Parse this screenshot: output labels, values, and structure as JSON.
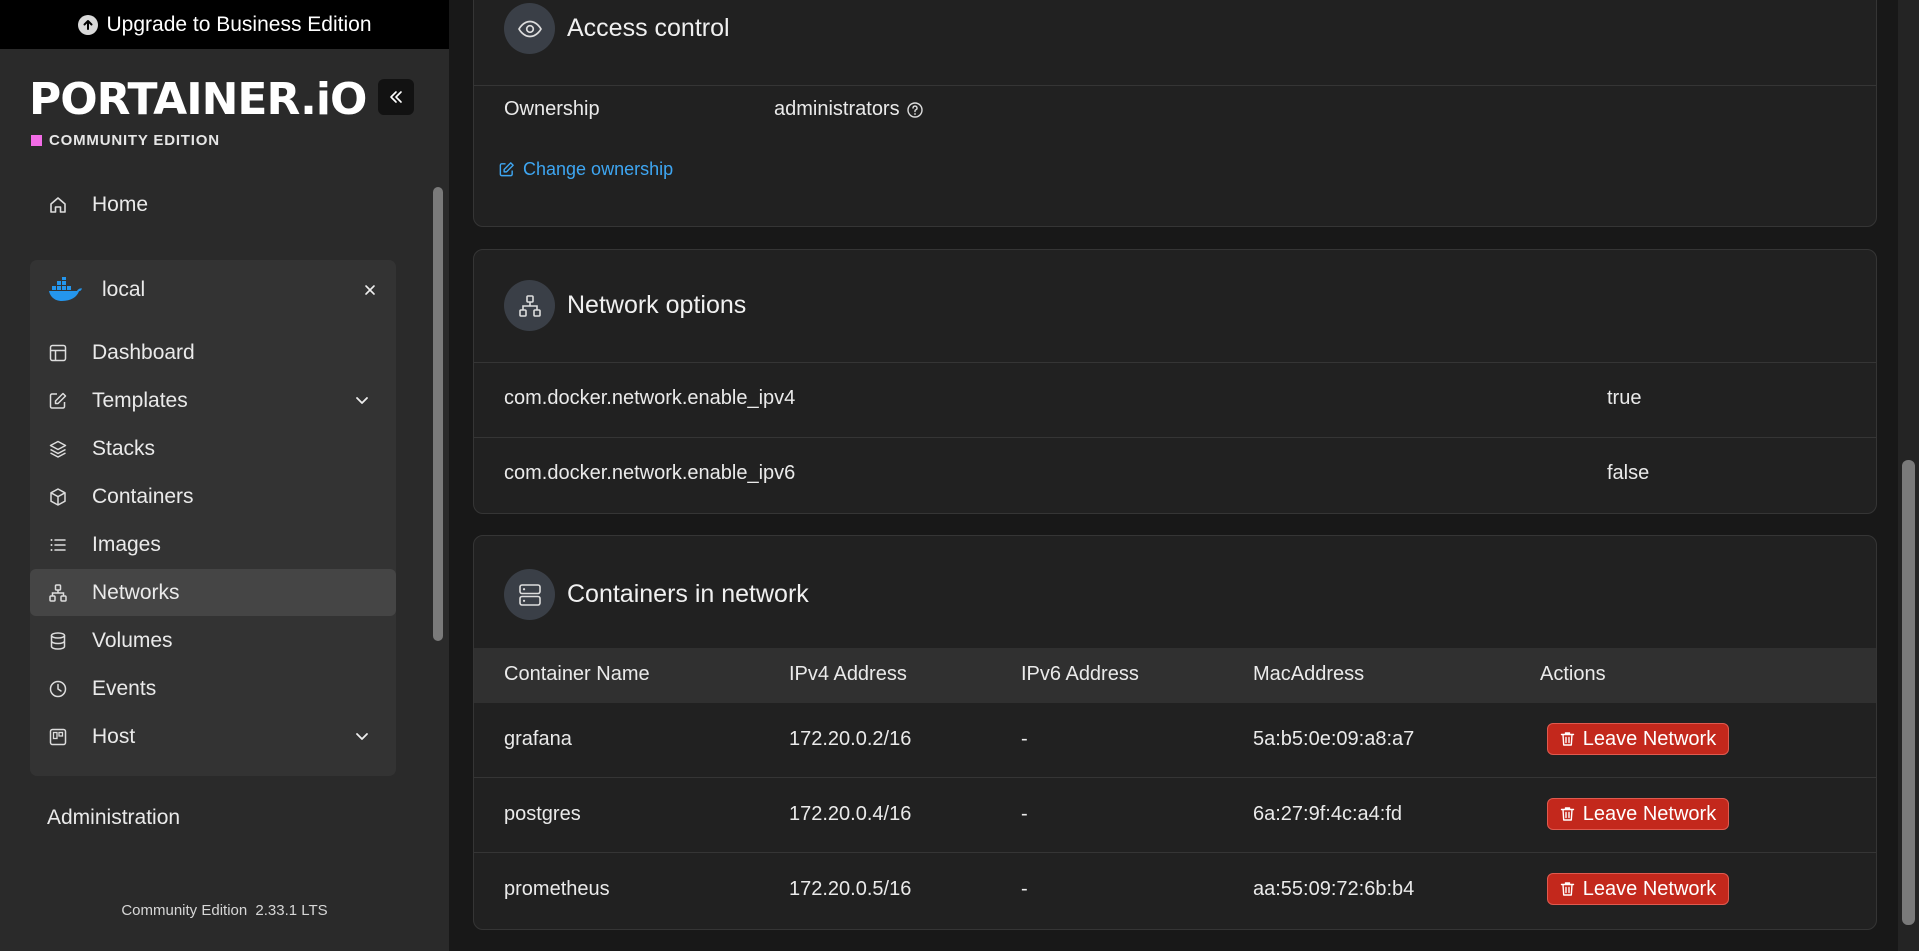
{
  "upgrade": {
    "label": "Upgrade to Business Edition"
  },
  "brand": {
    "logo_text": "PORTAINER.iO",
    "edition": "COMMUNITY EDITION"
  },
  "sidebar": {
    "home": "Home",
    "environment": {
      "name": "local"
    },
    "items": [
      {
        "label": "Dashboard",
        "icon": "dashboard-icon"
      },
      {
        "label": "Templates",
        "icon": "edit-icon",
        "expandable": true
      },
      {
        "label": "Stacks",
        "icon": "layers-icon"
      },
      {
        "label": "Containers",
        "icon": "box-icon"
      },
      {
        "label": "Images",
        "icon": "list-icon"
      },
      {
        "label": "Networks",
        "icon": "network-icon",
        "active": true
      },
      {
        "label": "Volumes",
        "icon": "database-icon"
      },
      {
        "label": "Events",
        "icon": "clock-icon"
      },
      {
        "label": "Host",
        "icon": "host-icon",
        "expandable": true
      }
    ],
    "administration": "Administration",
    "footer": {
      "edition": "Community Edition",
      "version": "2.33.1 LTS"
    }
  },
  "access_control": {
    "title": "Access control",
    "ownership_label": "Ownership",
    "ownership_value": "administrators",
    "change_link": "Change ownership"
  },
  "network_options": {
    "title": "Network options",
    "rows": [
      {
        "key": "com.docker.network.enable_ipv4",
        "value": "true"
      },
      {
        "key": "com.docker.network.enable_ipv6",
        "value": "false"
      }
    ]
  },
  "containers": {
    "title": "Containers in network",
    "columns": [
      "Container Name",
      "IPv4 Address",
      "IPv6 Address",
      "MacAddress",
      "Actions"
    ],
    "rows": [
      {
        "name": "grafana",
        "ipv4": "172.20.0.2/16",
        "ipv6": "-",
        "mac": "5a:b5:0e:09:a8:a7",
        "action": "Leave Network"
      },
      {
        "name": "postgres",
        "ipv4": "172.20.0.4/16",
        "ipv6": "-",
        "mac": "6a:27:9f:4c:a4:fd",
        "action": "Leave Network"
      },
      {
        "name": "prometheus",
        "ipv4": "172.20.0.5/16",
        "ipv6": "-",
        "mac": "aa:55:09:72:6b:b4",
        "action": "Leave Network"
      }
    ]
  },
  "colors": {
    "accent_link": "#3ea6f2",
    "danger": "#c3281c",
    "brand_pink": "#f26ce6"
  }
}
